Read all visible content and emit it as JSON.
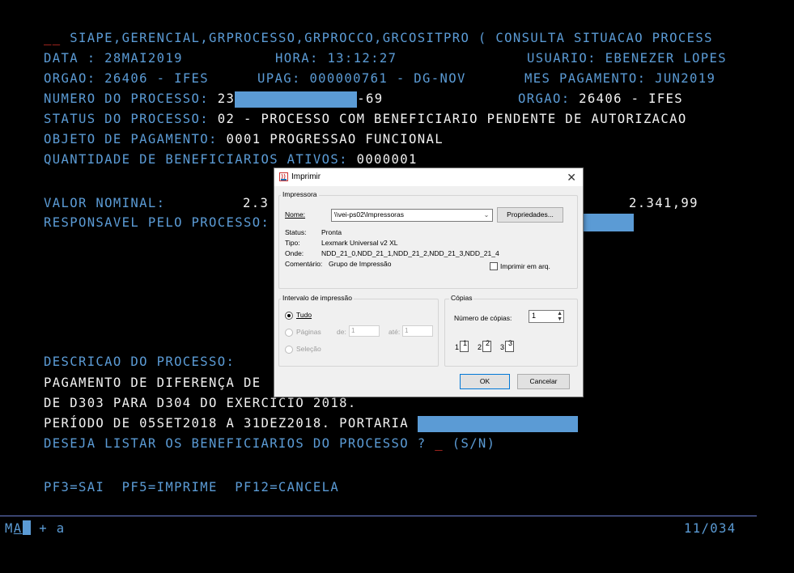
{
  "terminal": {
    "l1_prefix": "__",
    "l1_rest": " SIAPE,GERENCIAL,GRPROCESSO,GRPROCCO,GRCOSITPRO ( CONSULTA SITUACAO PROCESS",
    "data_label": "DATA : ",
    "data_value": "28MAI2019",
    "hora_label": "HORA: ",
    "hora_value": "13:12:27",
    "usuario_label": "USUARIO: ",
    "usuario_value": "EBENEZER LOPES",
    "orgao_label": "ORGAO: ",
    "orgao_value": "26406 - IFES",
    "upag_label": "UPAG: ",
    "upag_value": "000000761 - DG-NOV",
    "mes_label": "MES PAGAMENTO: ",
    "mes_value": "JUN2019",
    "processo_label": "NUMERO DO PROCESSO: ",
    "processo_prefix": "23",
    "processo_suffix": "-69",
    "orgao2_label": "ORGAO: ",
    "orgao2_value": "26406 - IFES",
    "status_label": "STATUS DO PROCESSO: ",
    "status_value": "02 - PROCESSO COM BENEFICIARIO PENDENTE DE AUTORIZACAO",
    "objeto_label": "OBJETO DE PAGAMENTO: ",
    "objeto_value": "0001 PROGRESSAO FUNCIONAL",
    "qtd_label": "QUANTIDADE DE BENEFICIARIOS ATIVOS: ",
    "qtd_value": "0000001",
    "valor_label": "VALOR NOMINAL:",
    "valor_partial": "2.3",
    "valor_right": "2.341,99",
    "responsavel_label": "RESPONSAVEL PELO PROCESSO:",
    "descricao_label": "DESCRICAO DO PROCESSO:",
    "desc1": "PAGAMENTO DE DIFERENÇA DE",
    "desc2": "DE D303 PARA D304 DO EXERCICIO 2018.",
    "desc3": "PERÍODO DE 05SET2018 A 31DEZ2018. PORTARIA ",
    "listar_question": "DESEJA LISTAR OS BENEFICIARIOS DO PROCESSO ? ",
    "listar_input": "_",
    "listar_options": " (S/N)",
    "pf_keys": "PF3=SAI  PF5=IMPRIME  PF12=CANCELA",
    "status_left_a": "M",
    "status_left_b": "A",
    "status_left_c": " + a",
    "status_right": "11/034"
  },
  "dialog": {
    "title": "Imprimir",
    "close": "✕",
    "printer_group": "Impressora",
    "nome_label": "Nome:",
    "nome_value": "\\\\vei-ps02\\Impressoras",
    "propriedades": "Propriedades...",
    "status_label": "Status:",
    "status_value": "Pronta",
    "tipo_label": "Tipo:",
    "tipo_value": "Lexmark Universal v2 XL",
    "onde_label": "Onde:",
    "onde_value": "NDD_21_0,NDD_21_1,NDD_21_2,NDD_21_3,NDD_21_4",
    "comentario_label": "Comentário:",
    "comentario_value": "Grupo de Impressão",
    "imprimir_arq": "Imprimir em arq.",
    "intervalo_group": "Intervalo de impressão",
    "tudo": "Tudo",
    "paginas": "Páginas",
    "de_label": "de:",
    "de_value": "1",
    "ate_label": "até:",
    "ate_value": "1",
    "selecao": "Seleção",
    "copias_group": "Cópias",
    "num_copias_label": "Número de cópias:",
    "num_copias_value": "1",
    "collate_pages": [
      "1",
      "1",
      "2",
      "2",
      "3",
      "3"
    ],
    "ok": "OK",
    "cancelar": "Cancelar"
  },
  "colors": {
    "background": "#000000",
    "label": "#5b9bd5",
    "value": "#f2f2f2",
    "cursor": "#ff3b30"
  }
}
